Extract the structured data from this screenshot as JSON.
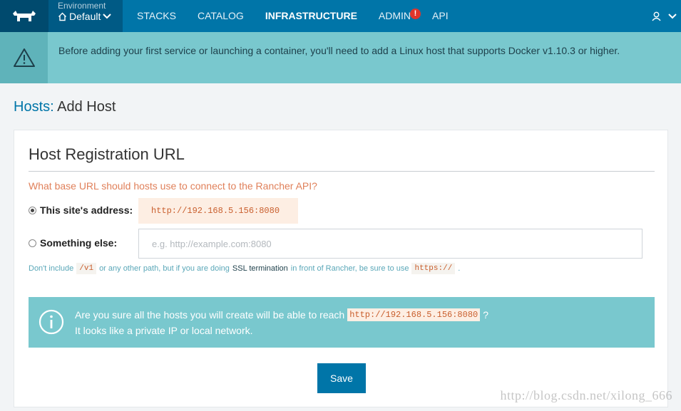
{
  "nav": {
    "environment_caption": "Environment",
    "environment_value": "Default",
    "items": [
      {
        "label": "STACKS"
      },
      {
        "label": "CATALOG"
      },
      {
        "label": "INFRASTRUCTURE",
        "active": true
      },
      {
        "label": "ADMIN",
        "badge": "!"
      },
      {
        "label": "API"
      }
    ]
  },
  "banner": {
    "text": "Before adding your first service or launching a container, you'll need to add a Linux host that supports Docker v1.10.3 or higher."
  },
  "page": {
    "breadcrumb": "Hosts:",
    "title": "Add Host"
  },
  "registration": {
    "title": "Host Registration URL",
    "question": "What base URL should hosts use to connect to the Rancher API?",
    "option_site_label": "This site's address:",
    "site_address": "http://192.168.5.156:8080",
    "option_else_label": "Something else:",
    "else_placeholder": "e.g. http://example.com:8080",
    "help_prefix": "Don't include",
    "help_code1": "/v1",
    "help_middle": "or any other path, but if you are doing",
    "help_ssl": "SSL termination",
    "help_after_ssl": "in front of Rancher, be sure to use",
    "help_code2": "https://",
    "help_end": "."
  },
  "info": {
    "line1_prefix": "Are you sure all the hosts you will create will be able to reach",
    "line1_code": "http://192.168.5.156:8080",
    "line1_suffix": "?",
    "line2": "It looks like a private IP or local network."
  },
  "actions": {
    "save_label": "Save"
  },
  "watermark": "http://blog.csdn.net/xilong_666",
  "colors": {
    "nav_bg": "#0075a8",
    "banner_bg": "#79c8ce",
    "accent_orange": "#e0805a",
    "button_bg": "#0075a8"
  }
}
